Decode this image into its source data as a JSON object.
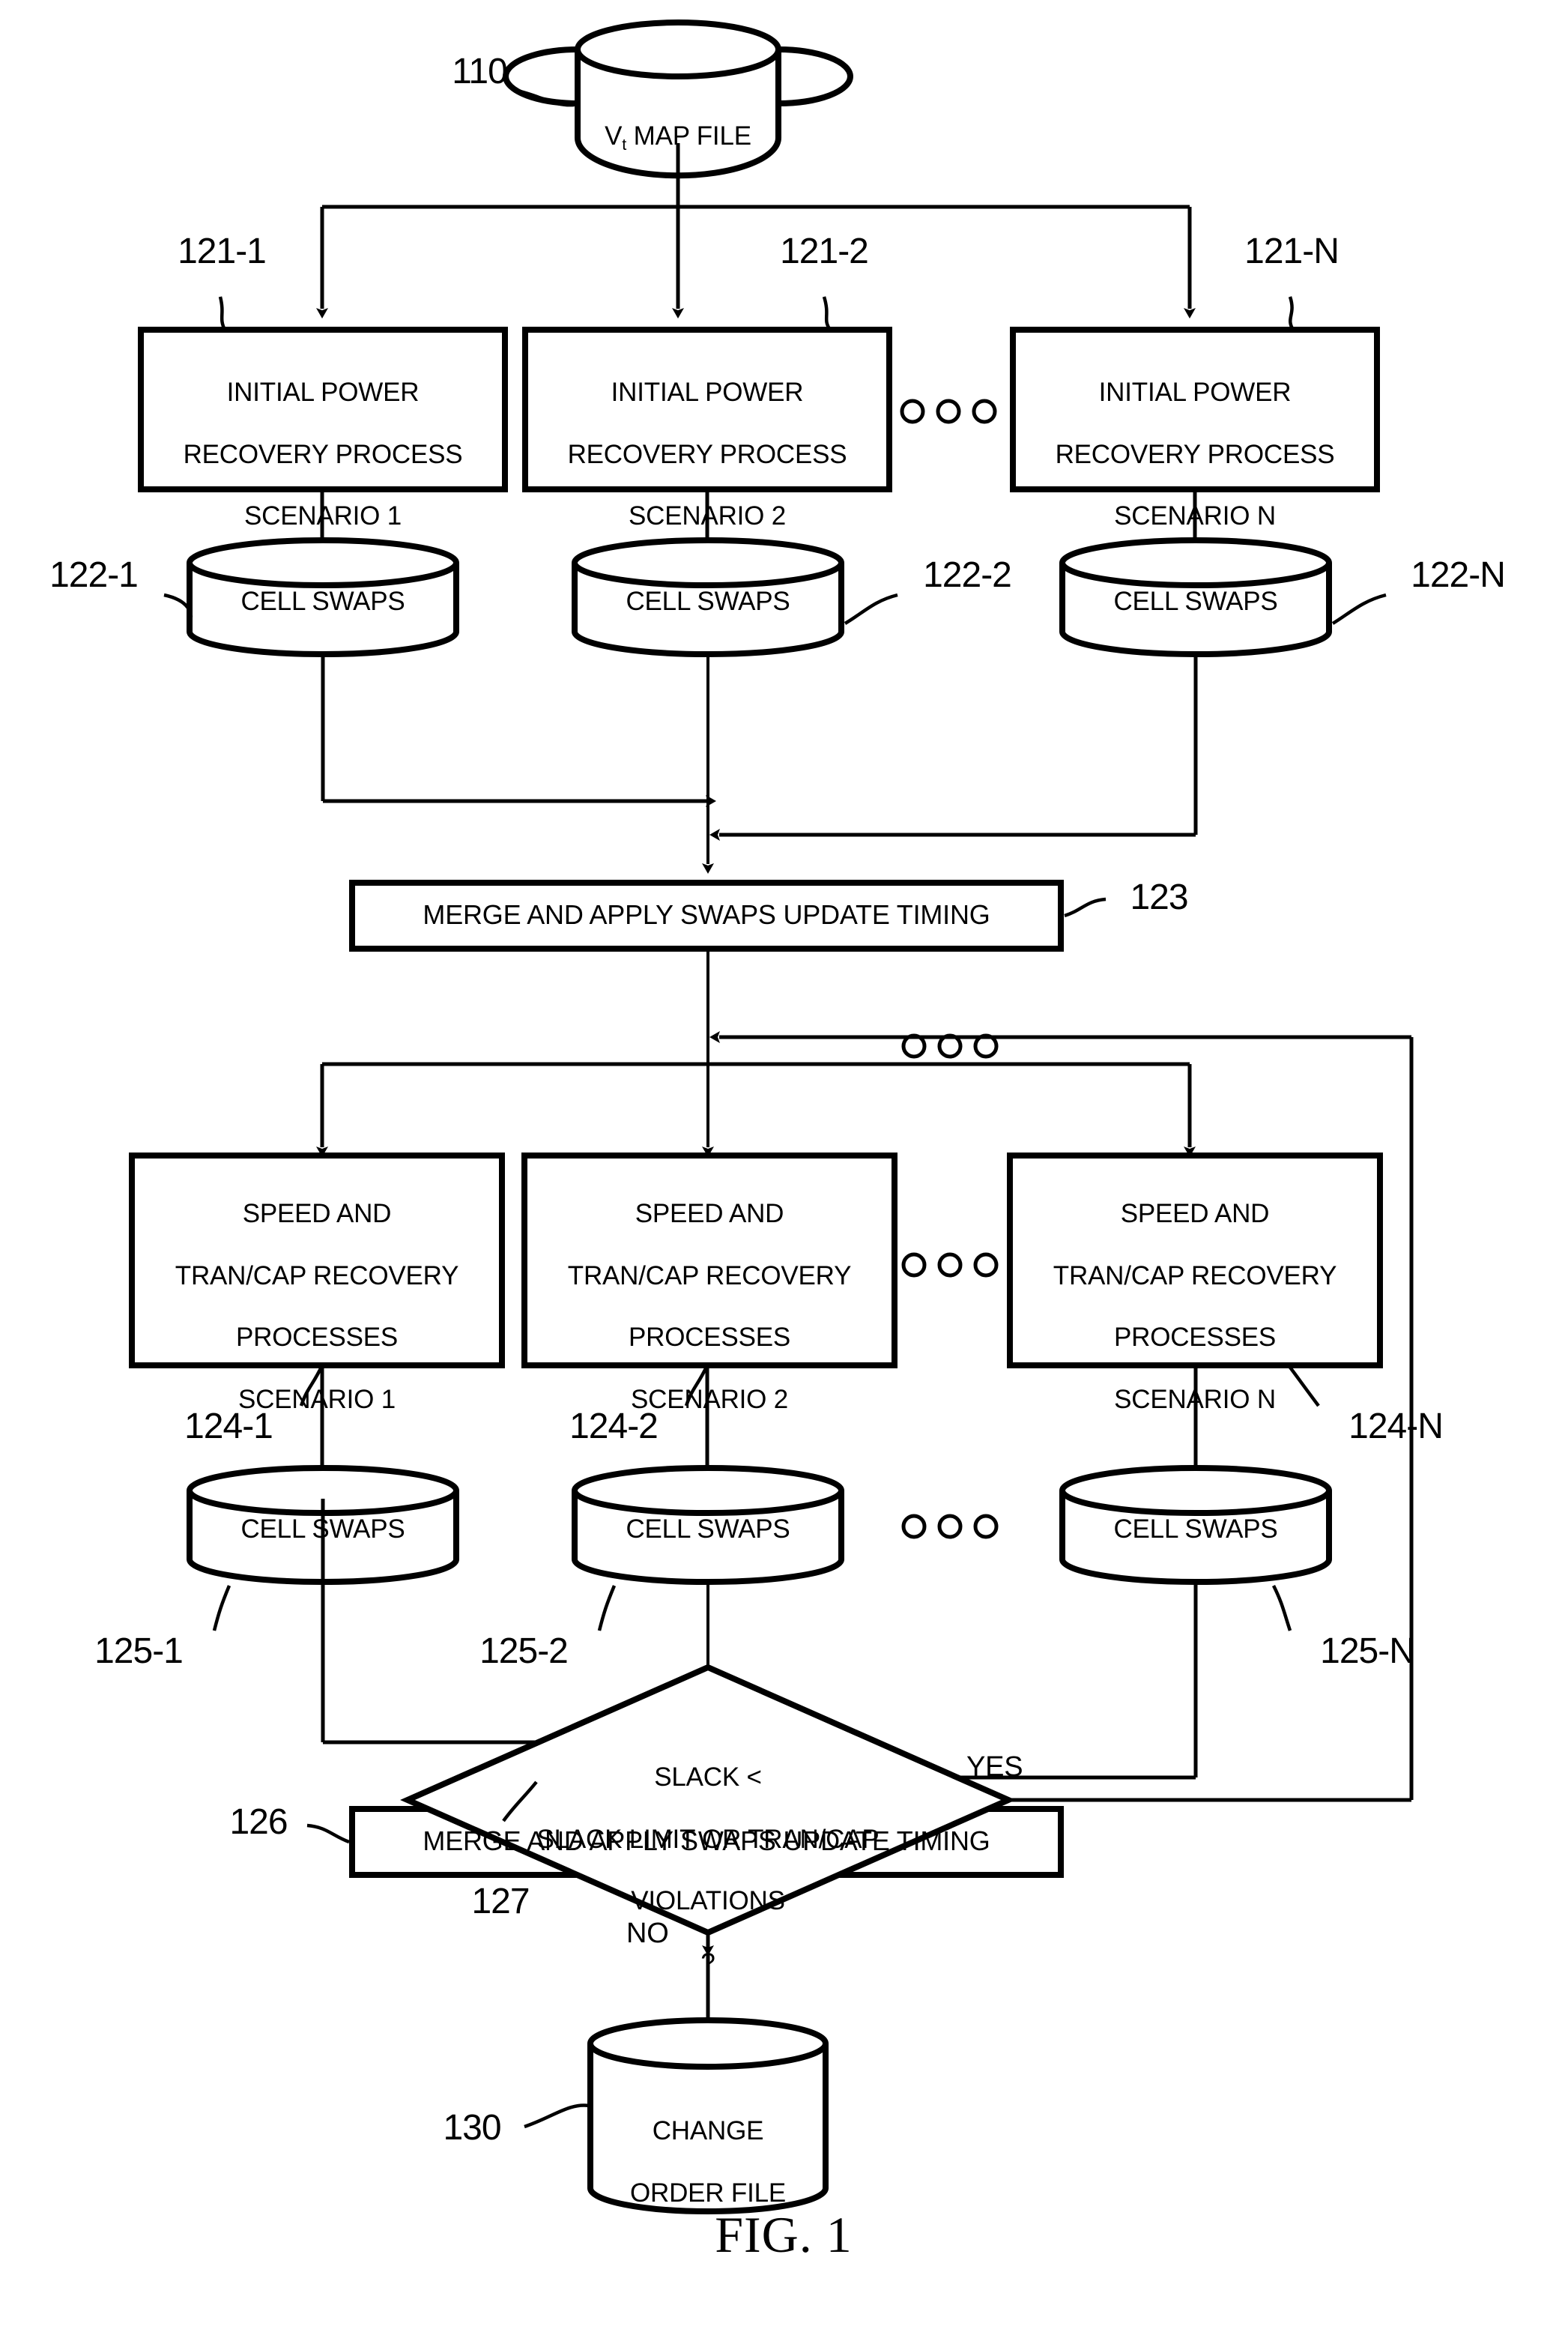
{
  "figure": {
    "caption": "FIG. 1",
    "title_node": {
      "id": "110",
      "label_prefix": "V",
      "label_sub": "t",
      "label_suffix": " MAP FILE"
    },
    "output_node": {
      "id": "130",
      "line1": "CHANGE",
      "line2": "ORDER FILE"
    },
    "stage1": {
      "processes": [
        {
          "id": "121-1",
          "line1": "INITIAL POWER",
          "line2": "RECOVERY PROCESS",
          "line3": "SCENARIO 1"
        },
        {
          "id": "121-2",
          "line1": "INITIAL POWER",
          "line2": "RECOVERY PROCESS",
          "line3": "SCENARIO 2"
        },
        {
          "id": "121-N",
          "line1": "INITIAL POWER",
          "line2": "RECOVERY PROCESS",
          "line3": "SCENARIO N"
        }
      ],
      "stores": [
        {
          "id": "122-1",
          "label": "CELL SWAPS"
        },
        {
          "id": "122-2",
          "label": "CELL SWAPS"
        },
        {
          "id": "122-N",
          "label": "CELL SWAPS"
        }
      ],
      "merge": {
        "id": "123",
        "label": "MERGE AND APPLY SWAPS UPDATE TIMING"
      },
      "ellipsis": "○ ○ ○"
    },
    "stage2": {
      "processes": [
        {
          "id": "",
          "line1": "SPEED AND",
          "line2": "TRAN/CAP RECOVERY",
          "line3": "PROCESSES",
          "line4": "SCENARIO 1"
        },
        {
          "id": "",
          "line1": "SPEED AND",
          "line2": "TRAN/CAP RECOVERY",
          "line3": "PROCESSES",
          "line4": "SCENARIO 2"
        },
        {
          "id": "",
          "line1": "SPEED AND",
          "line2": "TRAN/CAP RECOVERY",
          "line3": "PROCESSES",
          "line4": "SCENARIO N"
        }
      ],
      "process_ids": [
        "124-1",
        "124-2",
        "124-N"
      ],
      "stores": [
        {
          "id": "125-1",
          "label": "CELL SWAPS"
        },
        {
          "id": "125-2",
          "label": "CELL SWAPS"
        },
        {
          "id": "125-N",
          "label": "CELL SWAPS"
        }
      ],
      "merge": {
        "id": "126",
        "label": "MERGE AND APPLY SWAPS UPDATE TIMING"
      },
      "ellipsis": "○ ○ ○"
    },
    "decision": {
      "id": "127",
      "line1": "SLACK <",
      "line2": "SLACK LIMIT OR TRAN/CAP",
      "line3": "VIOLATIONS",
      "line4": "?",
      "yes_label": "YES",
      "no_label": "NO"
    },
    "colors": {
      "ink": "#000000",
      "paper": "#ffffff"
    }
  }
}
